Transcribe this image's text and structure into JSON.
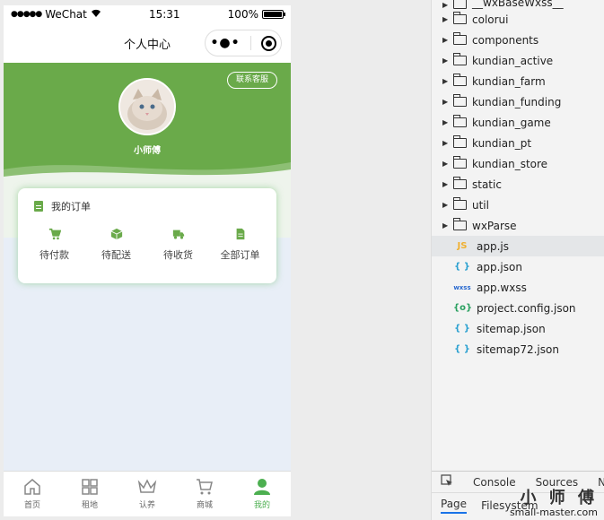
{
  "statusbar": {
    "carrier": "WeChat",
    "signal": "●●●●●",
    "time": "15:31",
    "battery": "100%"
  },
  "navbar": {
    "title": "个人中心",
    "capsule_more": "•●•"
  },
  "header": {
    "service_button": "联系客服",
    "username": "小师傅"
  },
  "orders": {
    "title": "我的订单",
    "items": [
      {
        "label": "待付款",
        "icon": "cart-icon"
      },
      {
        "label": "待配送",
        "icon": "box-icon"
      },
      {
        "label": "待收货",
        "icon": "truck-icon"
      },
      {
        "label": "全部订单",
        "icon": "document-icon"
      }
    ]
  },
  "tabbar": [
    {
      "label": "首页",
      "icon": "home-icon"
    },
    {
      "label": "租地",
      "icon": "grid-icon"
    },
    {
      "label": "认养",
      "icon": "crown-icon"
    },
    {
      "label": "商城",
      "icon": "cart-icon"
    },
    {
      "label": "我的",
      "icon": "user-icon",
      "active": true
    }
  ],
  "filetree": {
    "partial_top": "__wxBaseWxss__",
    "folders": [
      "colorui",
      "components",
      "kundian_active",
      "kundian_farm",
      "kundian_funding",
      "kundian_game",
      "kundian_pt",
      "kundian_store",
      "static",
      "util",
      "wxParse"
    ],
    "files": [
      {
        "name": "app.js",
        "badge": "JS",
        "color": "#f0b030",
        "selected": true
      },
      {
        "name": "app.json",
        "badge": "{ }",
        "color": "#2aa0d0"
      },
      {
        "name": "app.wxss",
        "badge": "wxss",
        "color": "#2a6ad0"
      },
      {
        "name": "project.config.json",
        "badge": "{o}",
        "color": "#2aa060"
      },
      {
        "name": "sitemap.json",
        "badge": "{ }",
        "color": "#2aa0d0"
      },
      {
        "name": "sitemap72.json",
        "badge": "{ }",
        "color": "#2aa0d0"
      }
    ]
  },
  "devtools": {
    "tabs_top": [
      "Console",
      "Sources",
      "N"
    ],
    "tabs_bottom": [
      "Page",
      "Filesystem"
    ]
  },
  "watermark": {
    "title": "小 师 傅",
    "url": "small-master.com"
  },
  "colors": {
    "brand_green": "#6aaa4a",
    "active_tab": "#4caf50"
  }
}
